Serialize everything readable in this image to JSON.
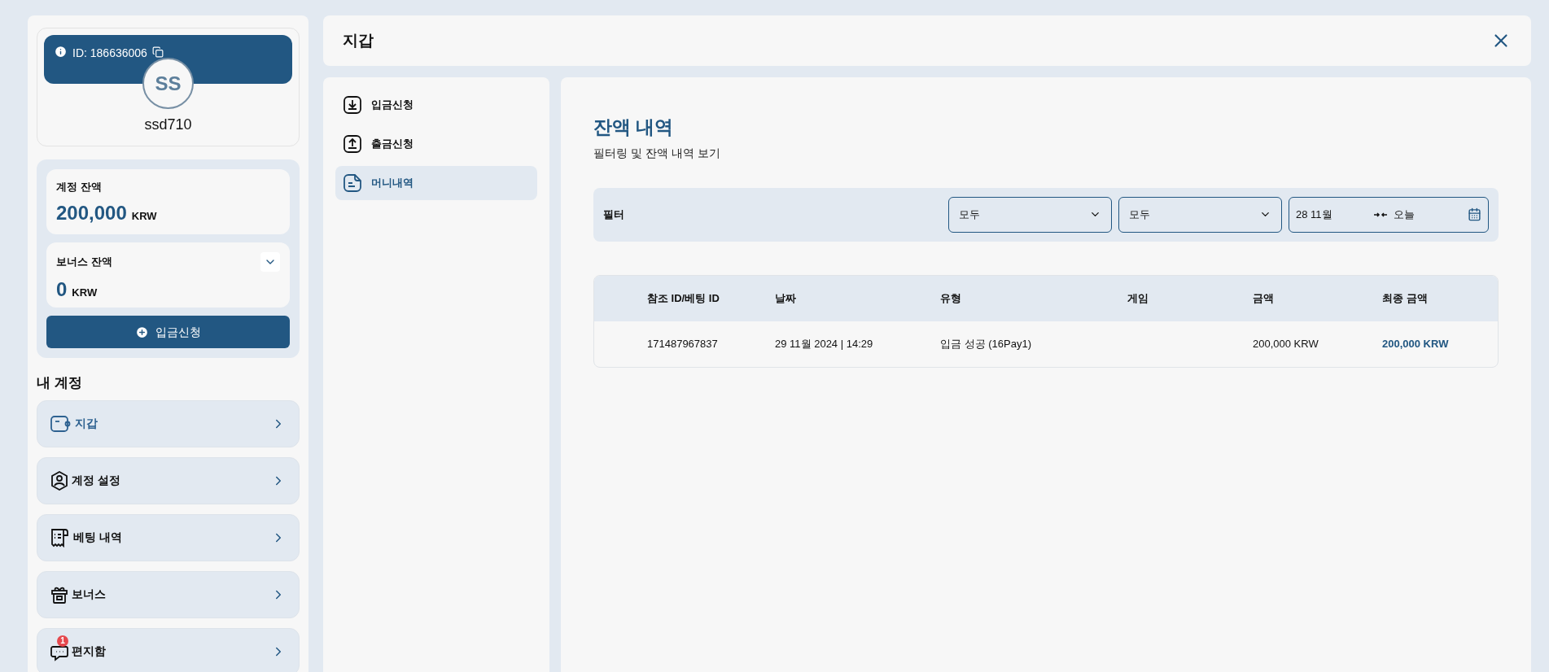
{
  "profile": {
    "id_label": "ID: 186636006",
    "initials": "SS",
    "username": "ssd710"
  },
  "balances": [
    {
      "kind": "plain",
      "label": "계정 잔액",
      "amount": "200,000",
      "currency": "KRW"
    },
    {
      "kind": "expandable",
      "label": "보너스 잔액",
      "amount": "0",
      "currency": "KRW"
    }
  ],
  "deposit_button": {
    "label": "입금신청"
  },
  "account_section": {
    "title": "내 계정",
    "items": [
      {
        "label": "지갑",
        "selected": true
      },
      {
        "label": "계정 설정",
        "selected": false
      },
      {
        "label": "베팅 내역",
        "selected": false
      },
      {
        "label": "보너스",
        "selected": false
      },
      {
        "label": "편지함",
        "selected": false,
        "badge": "1"
      }
    ]
  },
  "window": {
    "title": "지갑"
  },
  "wallet_nav": [
    {
      "label": "입금신청",
      "selected": false
    },
    {
      "label": "출금신청",
      "selected": false
    },
    {
      "label": "머니내역",
      "selected": true
    }
  ],
  "content": {
    "title": "잔액 내역",
    "subtitle": "필터링 및 잔액 내역 보기"
  },
  "filter": {
    "label": "필터",
    "selects": [
      {
        "value": "모두"
      },
      {
        "value": "모두"
      }
    ],
    "date_range": {
      "from": "28 11월",
      "to": "오늘"
    }
  },
  "table": {
    "columns": [
      "참조 ID/베팅 ID",
      "날짜",
      "유형",
      "게임",
      "금액",
      "최종 금액"
    ],
    "rows": [
      {
        "cells": [
          "171487967837",
          "29 11월 2024 | 14:29",
          "입금 성공 (16Pay1)",
          "",
          "200,000 KRW",
          "200,000 KRW"
        ]
      }
    ]
  }
}
